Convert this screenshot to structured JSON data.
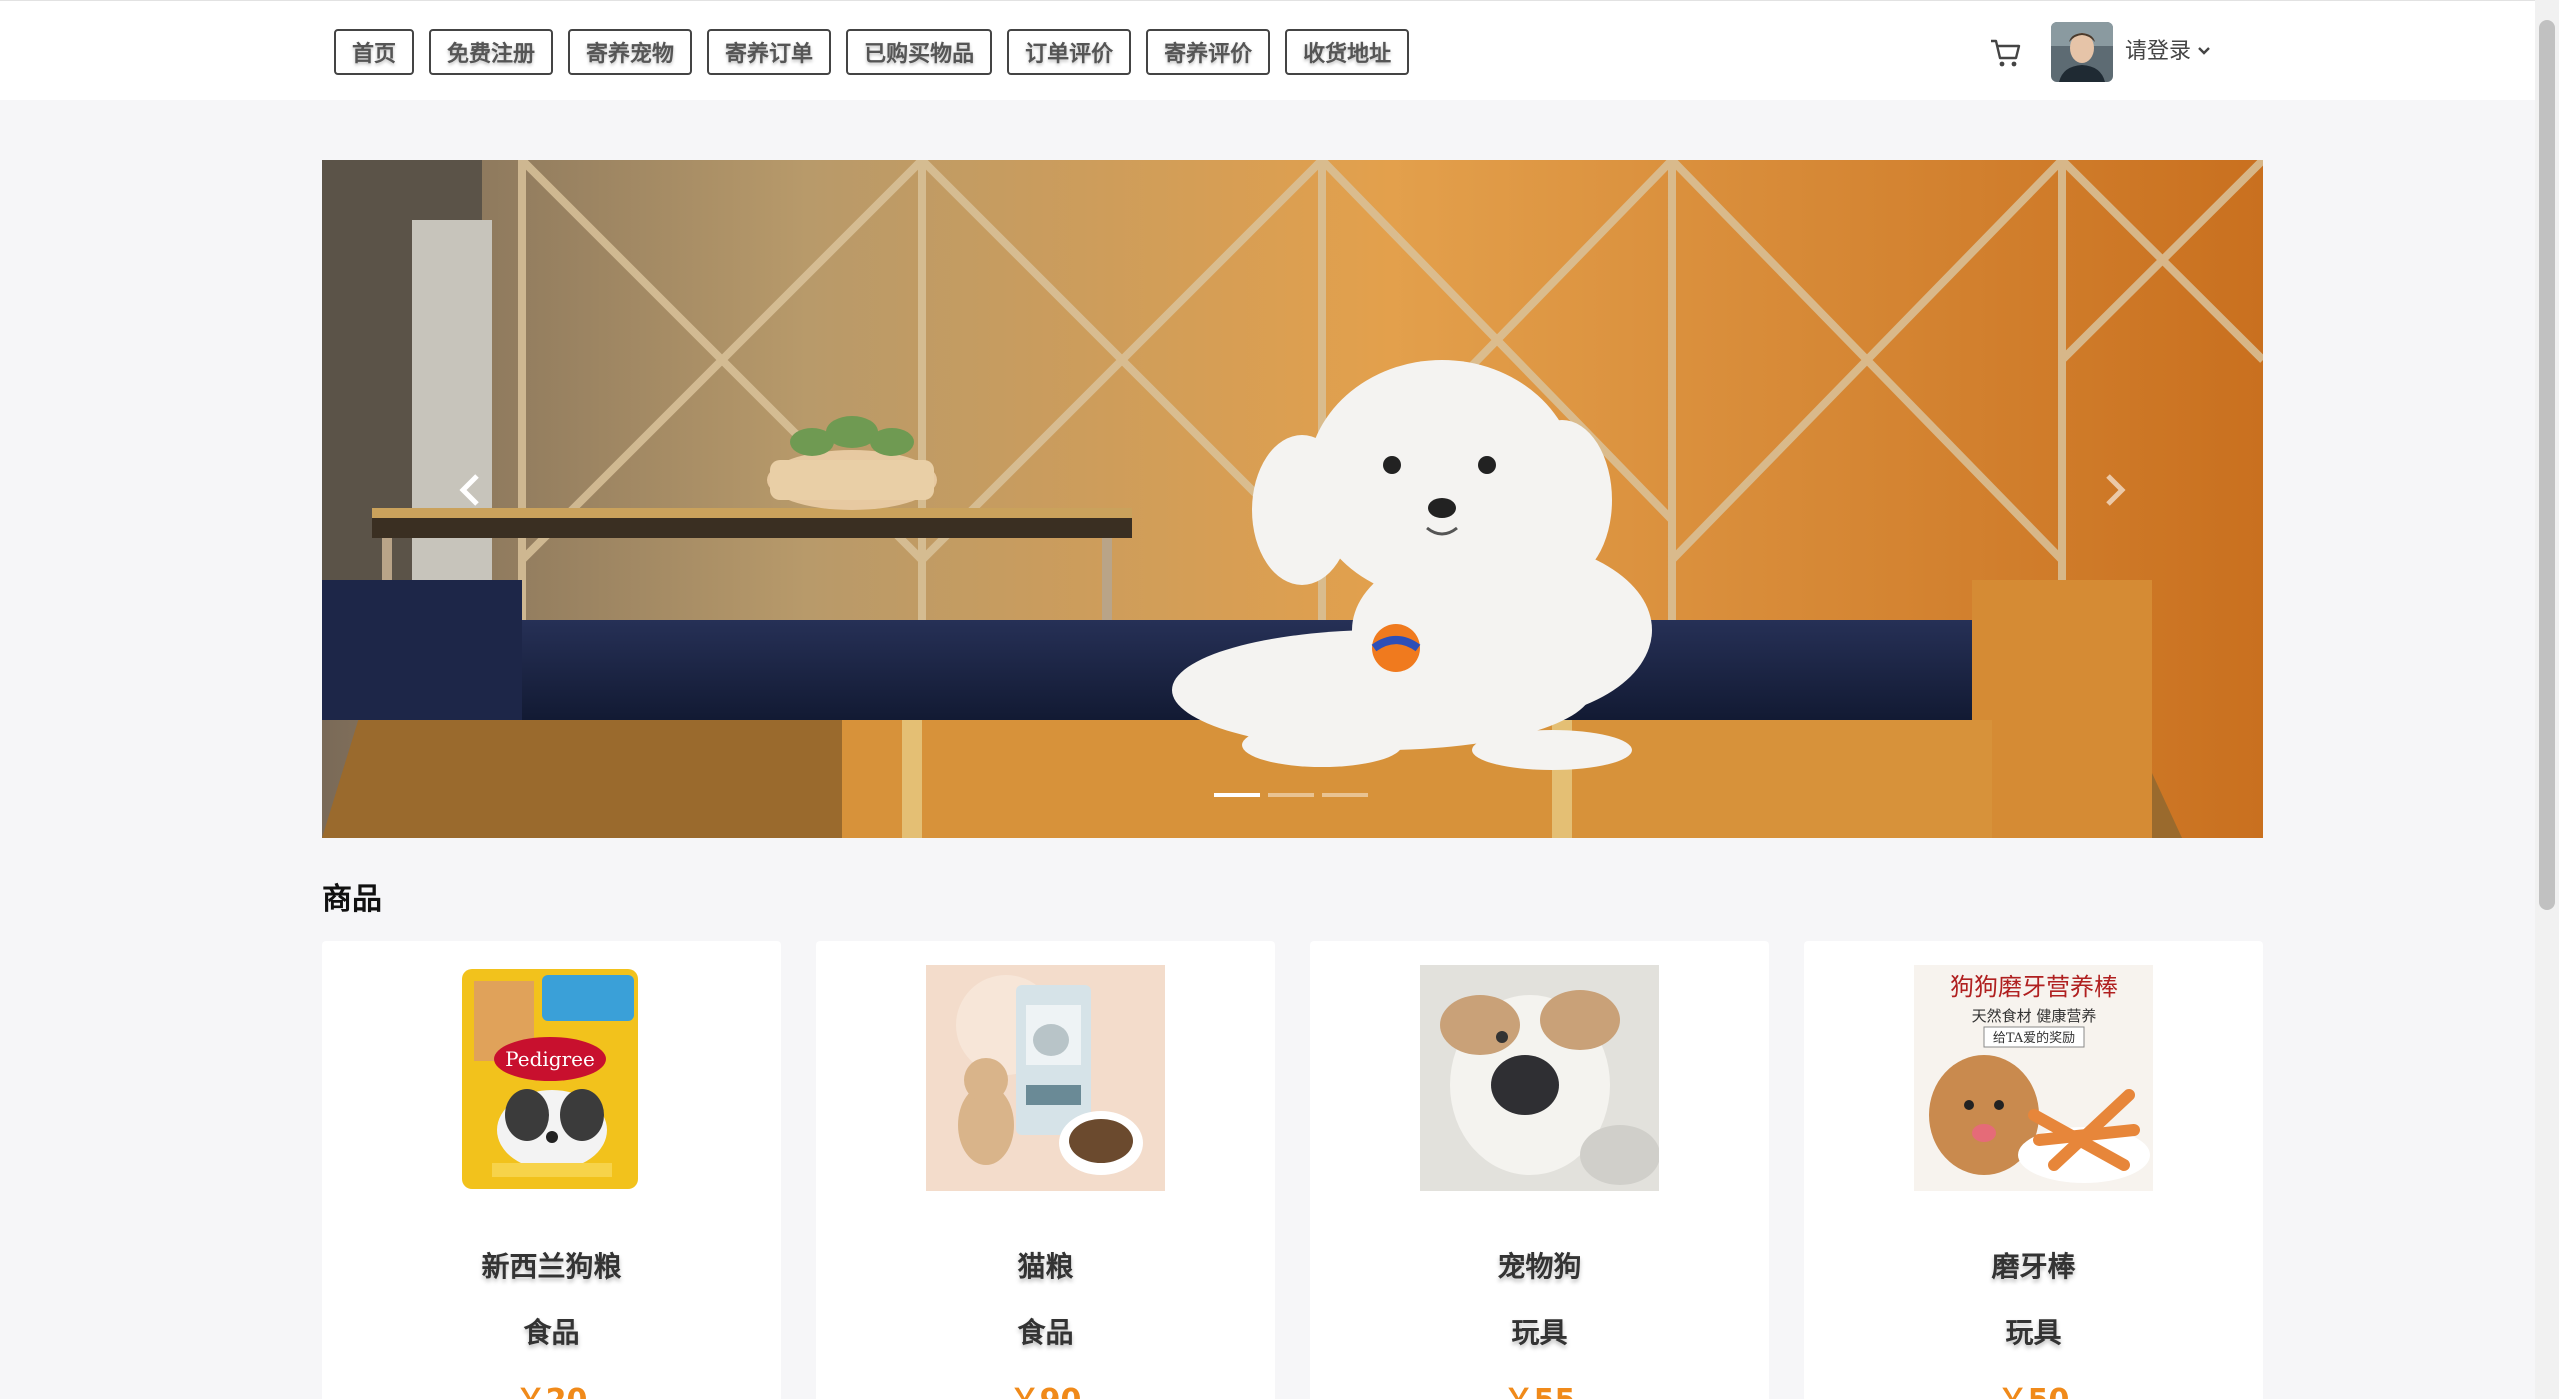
{
  "nav": {
    "items": [
      {
        "label": "首页"
      },
      {
        "label": "免费注册"
      },
      {
        "label": "寄养宠物"
      },
      {
        "label": "寄养订单"
      },
      {
        "label": "已购买物品"
      },
      {
        "label": "订单评价"
      },
      {
        "label": "寄养评价"
      },
      {
        "label": "收货地址"
      }
    ]
  },
  "header": {
    "cart_icon": "cart-icon",
    "login_label": "请登录",
    "dropdown_icon": "chevron-down-icon"
  },
  "carousel": {
    "prev_icon": "chevron-left-icon",
    "next_icon": "chevron-right-icon",
    "slide_count": 3,
    "active_slide": 0
  },
  "section": {
    "title": "商品"
  },
  "products": [
    {
      "name": "新西兰狗粮",
      "category": "食品",
      "price": "￥20"
    },
    {
      "name": "猫粮",
      "category": "食品",
      "price": "￥90"
    },
    {
      "name": "宠物狗",
      "category": "玩具",
      "price": "￥55"
    },
    {
      "name": "磨牙棒",
      "category": "玩具",
      "price": "￥50"
    }
  ],
  "product_images": {
    "p1_brand": "Pedigree",
    "p4_title": "狗狗磨牙营养棒",
    "p4_sub": "天然食材  健康营养",
    "p4_tag": "给TA爱的奖励"
  },
  "colors": {
    "price": "#f08a1a",
    "page_bg": "#f6f6f8"
  }
}
